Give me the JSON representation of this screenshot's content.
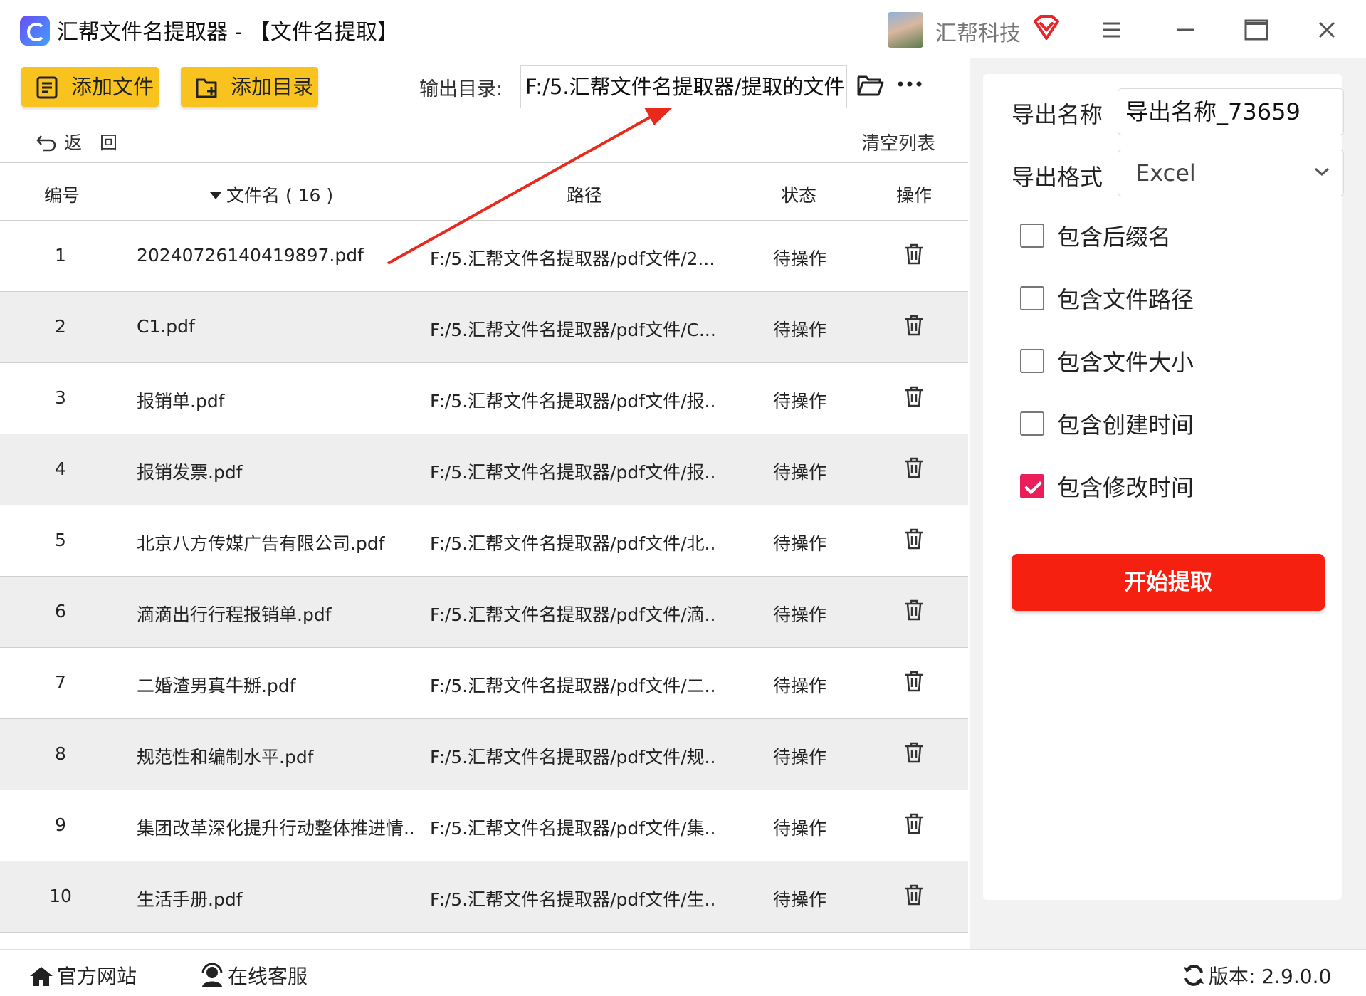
{
  "window": {
    "title": "汇帮文件名提取器 - 【文件名提取】",
    "company": "汇帮科技",
    "avatar": "avatar-icon"
  },
  "toolbar": {
    "add_file_label": "添加文件",
    "add_dir_label": "添加目录",
    "output_label": "输出目录:",
    "output_value": "F:/5.汇帮文件名提取器/提取的文件",
    "back_label": "返　回",
    "clear_label": "清空列表"
  },
  "table": {
    "headers": {
      "num": "编号",
      "name": "文件名 ( 16 )",
      "path": "路径",
      "status": "状态",
      "action": "操作"
    },
    "rows": [
      {
        "num": "1",
        "name": "20240726140419897.pdf",
        "path": "F:/5.汇帮文件名提取器/pdf文件/2...",
        "status": "待操作"
      },
      {
        "num": "2",
        "name": "C1.pdf",
        "path": "F:/5.汇帮文件名提取器/pdf文件/C...",
        "status": "待操作"
      },
      {
        "num": "3",
        "name": "报销单.pdf",
        "path": "F:/5.汇帮文件名提取器/pdf文件/报...",
        "status": "待操作"
      },
      {
        "num": "4",
        "name": "报销发票.pdf",
        "path": "F:/5.汇帮文件名提取器/pdf文件/报...",
        "status": "待操作"
      },
      {
        "num": "5",
        "name": "北京八方传媒广告有限公司.pdf",
        "path": "F:/5.汇帮文件名提取器/pdf文件/北...",
        "status": "待操作"
      },
      {
        "num": "6",
        "name": "滴滴出行行程报销单.pdf",
        "path": "F:/5.汇帮文件名提取器/pdf文件/滴...",
        "status": "待操作"
      },
      {
        "num": "7",
        "name": "二婚渣男真牛掰.pdf",
        "path": "F:/5.汇帮文件名提取器/pdf文件/二...",
        "status": "待操作"
      },
      {
        "num": "8",
        "name": "规范性和编制水平.pdf",
        "path": "F:/5.汇帮文件名提取器/pdf文件/规...",
        "status": "待操作"
      },
      {
        "num": "9",
        "name": "集团改革深化提升行动整体推进情...",
        "path": "F:/5.汇帮文件名提取器/pdf文件/集...",
        "status": "待操作"
      },
      {
        "num": "10",
        "name": "生活手册.pdf",
        "path": "F:/5.汇帮文件名提取器/pdf文件/生...",
        "status": "待操作"
      }
    ]
  },
  "right_panel": {
    "export_name_label": "导出名称",
    "export_name_value": "导出名称_73659",
    "export_format_label": "导出格式",
    "export_format_value": "Excel",
    "options": [
      {
        "label": "包含后缀名",
        "checked": false
      },
      {
        "label": "包含文件路径",
        "checked": false
      },
      {
        "label": "包含文件大小",
        "checked": false
      },
      {
        "label": "包含创建时间",
        "checked": false
      },
      {
        "label": "包含修改时间",
        "checked": true
      }
    ],
    "start_label": "开始提取"
  },
  "bottom": {
    "website_label": "官方网站",
    "service_label": "在线客服",
    "version_label": "版本: 2.9.0.0"
  },
  "colors": {
    "accent_yellow": "#f9c31f",
    "start_red": "#f5200f",
    "checkbox_pink": "#e91e5a",
    "annotation_red": "#e8291c"
  }
}
